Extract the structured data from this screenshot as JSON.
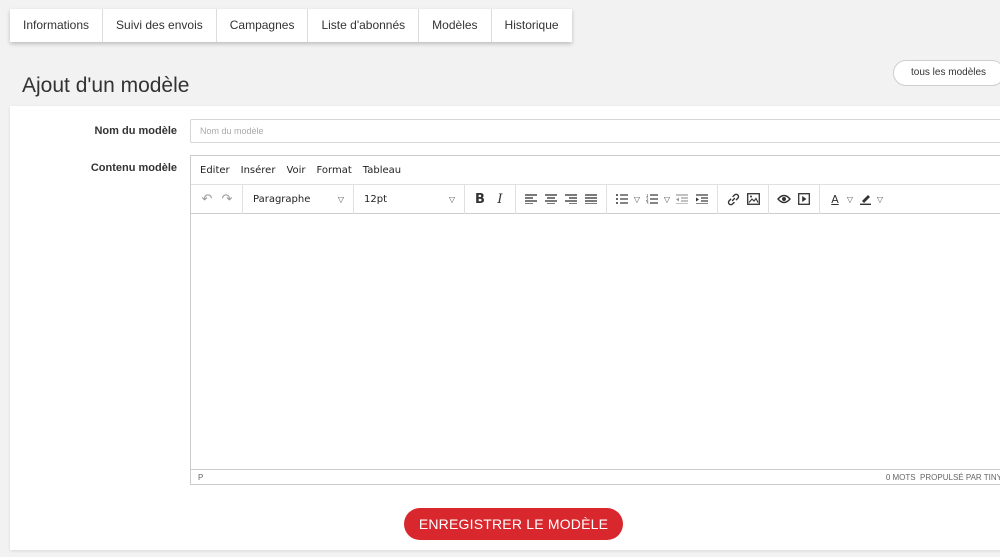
{
  "tabs": [
    "Informations",
    "Suivi des envois",
    "Campagnes",
    "Liste d'abonnés",
    "Modèles",
    "Historique"
  ],
  "page": {
    "title": "Ajout d'un modèle",
    "all_models_button": "tous les modèles"
  },
  "form": {
    "name_label": "Nom du modèle",
    "name_placeholder": "Nom du modèle",
    "name_value": "",
    "content_label": "Contenu modèle"
  },
  "editor": {
    "menu": [
      "Editer",
      "Insérer",
      "Voir",
      "Format",
      "Tableau"
    ],
    "block_format": "Paragraphe",
    "font_size": "12pt",
    "status_path": "P",
    "word_count": "0 MOTS",
    "powered_by": "PROPULSÉ PAR TINY"
  },
  "save_button": "ENREGISTRER LE MODÈLE",
  "colors": {
    "accent": "#d9272e",
    "background": "#f2f2f2",
    "panel": "#ffffff"
  }
}
